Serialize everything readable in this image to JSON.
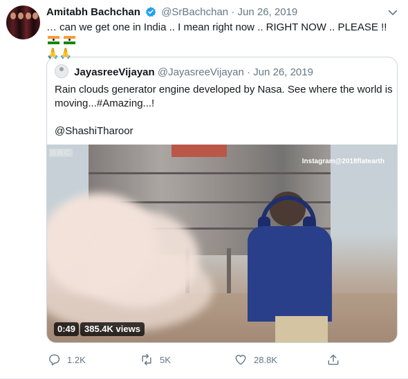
{
  "tweet": {
    "author": {
      "name": "Amitabh Bachchan",
      "handle": "@SrBachchan",
      "separator": "·",
      "date": "Jun 26, 2019",
      "verified": true
    },
    "text": "… can we get one in India .. I mean right now .. RIGHT NOW .. PLEASE !!",
    "emoji_line": "🙏🙏",
    "flags": [
      "india-flag",
      "india-flag"
    ]
  },
  "quote": {
    "author": {
      "name": "JayasreeVijayan",
      "handle": "@JayasreeVijayan",
      "separator": "·",
      "date": "Jun 26, 2019"
    },
    "text_line1": "Rain clouds generator  engine developed by Nasa. See where the world is moving...#Amazing...!",
    "mention": "@ShashiTharoor",
    "video": {
      "watermark_left": "BBC",
      "watermark_right": "Instagram@2018flatearth",
      "duration": "0:49",
      "views": "385.4K views"
    }
  },
  "actions": {
    "reply": {
      "icon": "reply-icon",
      "count": "1.2K"
    },
    "retweet": {
      "icon": "retweet-icon",
      "count": "5K"
    },
    "like": {
      "icon": "heart-icon",
      "count": "28.8K"
    },
    "share": {
      "icon": "share-icon"
    }
  },
  "colors": {
    "text": "#14171a",
    "muted": "#657786",
    "verified": "#1da1f2",
    "border": "#ccd6dd"
  }
}
